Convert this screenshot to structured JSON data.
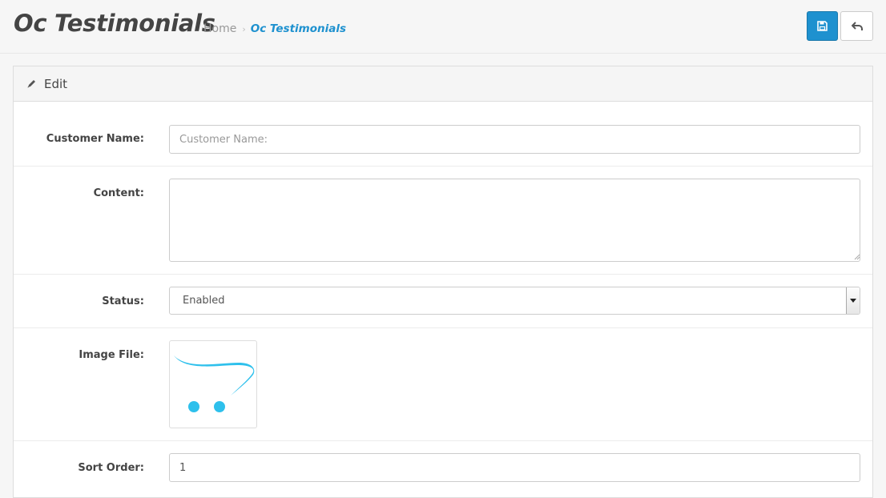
{
  "header": {
    "title": "Oc Testimonials",
    "breadcrumb": [
      {
        "label": "Home"
      },
      {
        "label": "Oc Testimonials"
      }
    ],
    "separator": "›",
    "save_icon": "floppy-disk-icon",
    "back_icon": "reply-arrow-icon"
  },
  "panel": {
    "heading": "Edit",
    "heading_icon": "pencil-icon"
  },
  "form": {
    "customer_name": {
      "label": "Customer Name:",
      "placeholder": "Customer Name:",
      "value": ""
    },
    "content": {
      "label": "Content:",
      "value": ""
    },
    "status": {
      "label": "Status:",
      "value": "Enabled"
    },
    "image": {
      "label": "Image File:",
      "icon": "opencart-cart-logo"
    },
    "sort_order": {
      "label": "Sort Order:",
      "value": "1"
    }
  },
  "colors": {
    "accent": "#1e91cf",
    "logo": "#2ec0ec"
  }
}
